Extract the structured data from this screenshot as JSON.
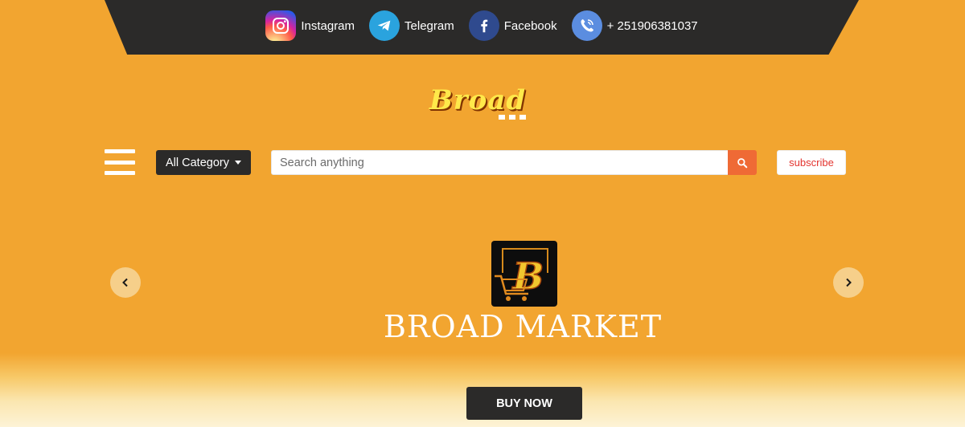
{
  "topbar": {
    "social": [
      {
        "label": "Instagram",
        "icon": "instagram-icon"
      },
      {
        "label": "Telegram",
        "icon": "telegram-icon"
      },
      {
        "label": "Facebook",
        "icon": "facebook-icon"
      },
      {
        "label": "+ 251906381037",
        "icon": "viber-phone-icon"
      }
    ]
  },
  "logo": {
    "text": "Broad"
  },
  "nav": {
    "menu_icon": "hamburger-menu-icon",
    "category_label": "All Category",
    "search_placeholder": "Search anything",
    "search_icon": "search-icon",
    "subscribe_label": "subscribe"
  },
  "hero": {
    "brand_name": "BROAD MARKET",
    "logo_letter": "B",
    "buy_label": "BUY NOW"
  },
  "colors": {
    "background": "#f2a530",
    "dark": "#2b2a29",
    "accent": "#ef6a35",
    "subscribe_text": "#e3342f"
  }
}
